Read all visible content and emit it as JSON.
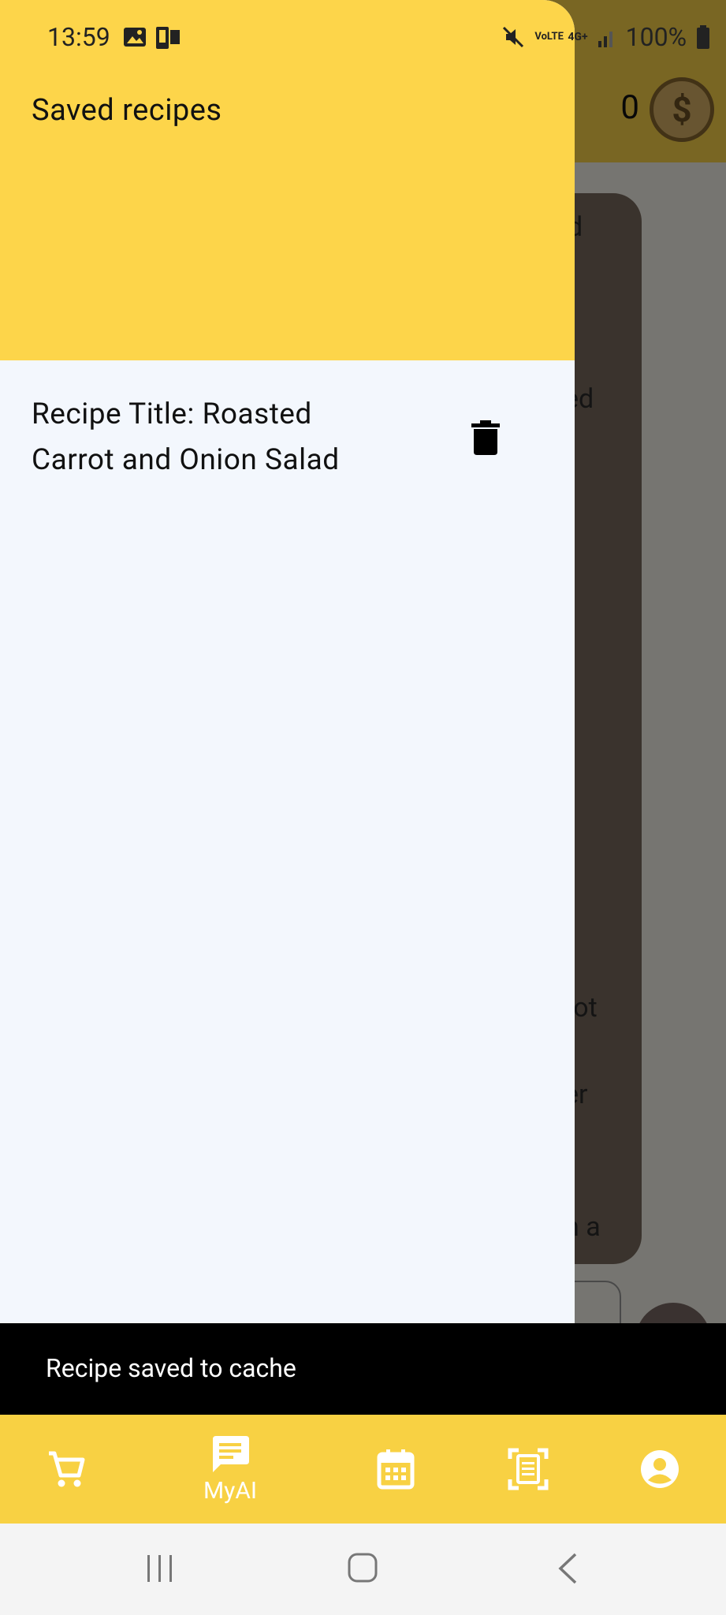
{
  "status_bar": {
    "time": "13:59",
    "battery": "100%",
    "network": "4G+",
    "volte": "VoLTE"
  },
  "app_header": {
    "coin_count": "0",
    "coin_symbol": "$"
  },
  "background_fragments": [
    "d",
    "ed",
    "rot",
    "er",
    "n a"
  ],
  "drawer": {
    "title": "Saved recipes",
    "recipes": [
      {
        "title": "Recipe Title: Roasted Carrot and Onion Salad"
      }
    ]
  },
  "snackbar": {
    "message": "Recipe saved to cache"
  },
  "bottom_nav": {
    "items": [
      {
        "icon": "cart-icon",
        "label": ""
      },
      {
        "icon": "chat-icon",
        "label": "MyAI"
      },
      {
        "icon": "calendar-icon",
        "label": ""
      },
      {
        "icon": "scan-icon",
        "label": ""
      },
      {
        "icon": "account-icon",
        "label": ""
      }
    ]
  },
  "colors": {
    "accent": "#FDD54A",
    "nav": "#F8D143",
    "drawer_bg": "#F3F7FD",
    "snackbar_bg": "#000000"
  }
}
